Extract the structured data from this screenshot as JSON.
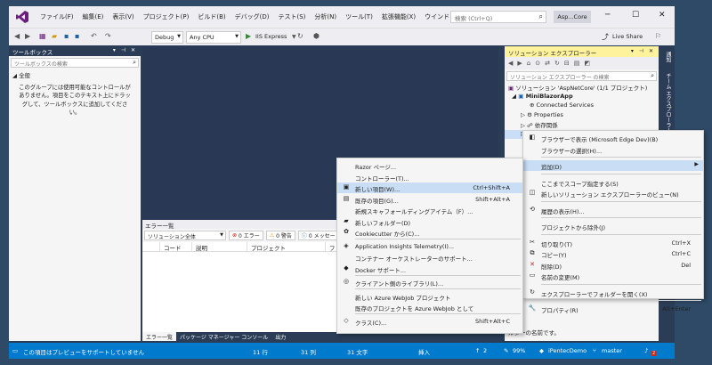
{
  "titlebar": {
    "menus": [
      "ファイル(F)",
      "編集(E)",
      "表示(V)",
      "プロジェクト(P)",
      "ビルド(B)",
      "デバッグ(D)",
      "テスト(S)",
      "分析(N)",
      "ツール(T)",
      "拡張機能(X)",
      "ウインドウ(W)",
      "ヘルプ(H)"
    ],
    "search_placeholder": "検索 (Ctrl+Q)",
    "project": "Asp...Core",
    "minimize": "─",
    "restore": "☐",
    "close": "✕"
  },
  "toolbar": {
    "config": "Debug",
    "platform": "Any CPU",
    "run": "IIS Express",
    "live_share": "Live Share"
  },
  "toolbox": {
    "title": "ツールボックス",
    "search_placeholder": "ツールボックスの検索",
    "group": "全般",
    "empty_message": "このグループには使用可能なコントロールがありません。項目をこのテキスト上にドラッグして、ツールボックスに追加してください。"
  },
  "error_list": {
    "title": "エラー一覧",
    "scope": "ソリューション全体",
    "errors": "0 エラー",
    "warnings": "0 警告",
    "messages": "0 メッセー",
    "columns": [
      "コード",
      "説明",
      "プロジェクト",
      "フ"
    ],
    "tabs": [
      "エラー一覧",
      "パッケージ マネージャー コンソール",
      "出力"
    ]
  },
  "solution_explorer": {
    "title": "ソリューション エクスプローラー",
    "search_placeholder": "ソリューション エクスプローラー の検索",
    "tree": [
      {
        "label": "ソリューション 'AspNetCore' (1/1 プロジェクト)"
      },
      {
        "label": "MiniBlazorApp"
      },
      {
        "label": "Connected Services"
      },
      {
        "label": "Properties"
      },
      {
        "label": "依存関係"
      }
    ],
    "prop_name": "ー名",
    "prop_desc": "ルダーの名前です。"
  },
  "side_tabs": [
    "通知",
    "チーム エクスプローラー"
  ],
  "status_bar": {
    "message": "この項目はプレビューをサポートしていません",
    "line": "11 行",
    "col": "31 列",
    "char": "31 文字",
    "mode": "挿入",
    "up": "2",
    "pencil": "99%",
    "repo": "iPentecDemo",
    "branch": "master",
    "notif": "2"
  },
  "context_menu_add": [
    {
      "icon": "",
      "label": "Razor ページ..."
    },
    {
      "icon": "",
      "label": "コントローラー(T)..."
    },
    {
      "icon": "▣",
      "label": "新しい項目(W)...",
      "shortcut": "Ctrl+Shift+A",
      "highlight": true
    },
    {
      "icon": "▤",
      "label": "既存の項目(G)...",
      "shortcut": "Shift+Alt+A"
    },
    {
      "icon": "",
      "label": "新規スキャフォールディングアイテム（F）..."
    },
    {
      "icon": "▰",
      "label": "新しいフォルダー(D)"
    },
    {
      "icon": "✿",
      "label": "Cookiecutter から(C)..."
    },
    {
      "icon": "◈",
      "label": "Application Insights Telemetry(I)...",
      "sep_before": true
    },
    {
      "icon": "",
      "label": "コンテナー オーケストレーターのサポート..."
    },
    {
      "icon": "◆",
      "label": "Docker サポート..."
    },
    {
      "icon": "◎",
      "label": "クライアント側のライブラリ(L)...",
      "sep_before": true
    },
    {
      "icon": "",
      "label": "新しい Azure WebJob プロジェクト",
      "sep_before": true
    },
    {
      "icon": "",
      "label": "既存のプロジェクトを Azure WebJob として"
    },
    {
      "icon": "◇",
      "label": "クラス(C)...",
      "shortcut": "Shift+Alt+C",
      "sep_before": true
    }
  ],
  "context_menu_main": [
    {
      "icon": "◧",
      "label": "ブラウザーで表示 (Microsoft Edge Dev)(B)"
    },
    {
      "icon": "",
      "label": "ブラウザーの選択(H)..."
    },
    {
      "icon": "",
      "label": "追加(D)",
      "submenu": true,
      "highlight": true,
      "sep_before": true
    },
    {
      "icon": "",
      "label": "ここまでスコープ指定する(S)",
      "sep_before": true
    },
    {
      "icon": "◫",
      "label": "新しいソリューション エクスプローラーのビュー(N)"
    },
    {
      "icon": "⟲",
      "label": "履歴の表示(H)...",
      "sep_before": true
    },
    {
      "icon": "",
      "label": "プロジェクトから除外(J)",
      "sep_before": true
    },
    {
      "icon": "✂",
      "label": "切り取り(T)",
      "shortcut": "Ctrl+X",
      "sep_before": true
    },
    {
      "icon": "⧉",
      "label": "コピー(Y)",
      "shortcut": "Ctrl+C"
    },
    {
      "icon": "✕",
      "label": "削除(D)",
      "shortcut": "Del",
      "color": "#c42b1c"
    },
    {
      "icon": "▭",
      "label": "名前の変更(M)"
    },
    {
      "icon": "↻",
      "label": "エクスプローラーでフォルダーを開く(X)",
      "sep_before": true
    },
    {
      "icon": "🔧",
      "label": "プロパティ(R)",
      "shortcut": "Alt+Enter",
      "sep_before": true
    }
  ]
}
